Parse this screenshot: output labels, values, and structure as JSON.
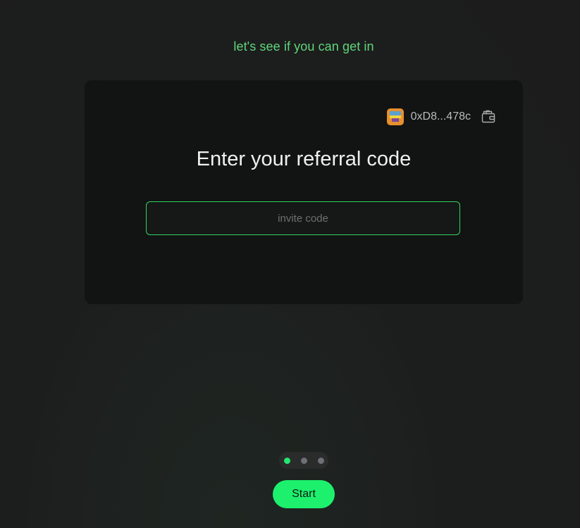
{
  "header": {
    "tagline": "let's see if you can get in"
  },
  "card": {
    "wallet": {
      "address": "0xD8...478c",
      "avatar_icon": "pixel-avatar-icon",
      "wallet_icon": "wallet-icon"
    },
    "title": "Enter your referral code",
    "invite_input": {
      "value": "",
      "placeholder": "invite code"
    }
  },
  "pagination": {
    "total": 3,
    "active_index": 0
  },
  "footer": {
    "start_label": "Start"
  },
  "colors": {
    "accent": "#1df06d",
    "tagline": "#5fd67a",
    "background": "#1c1e1e",
    "card": "#121313"
  }
}
